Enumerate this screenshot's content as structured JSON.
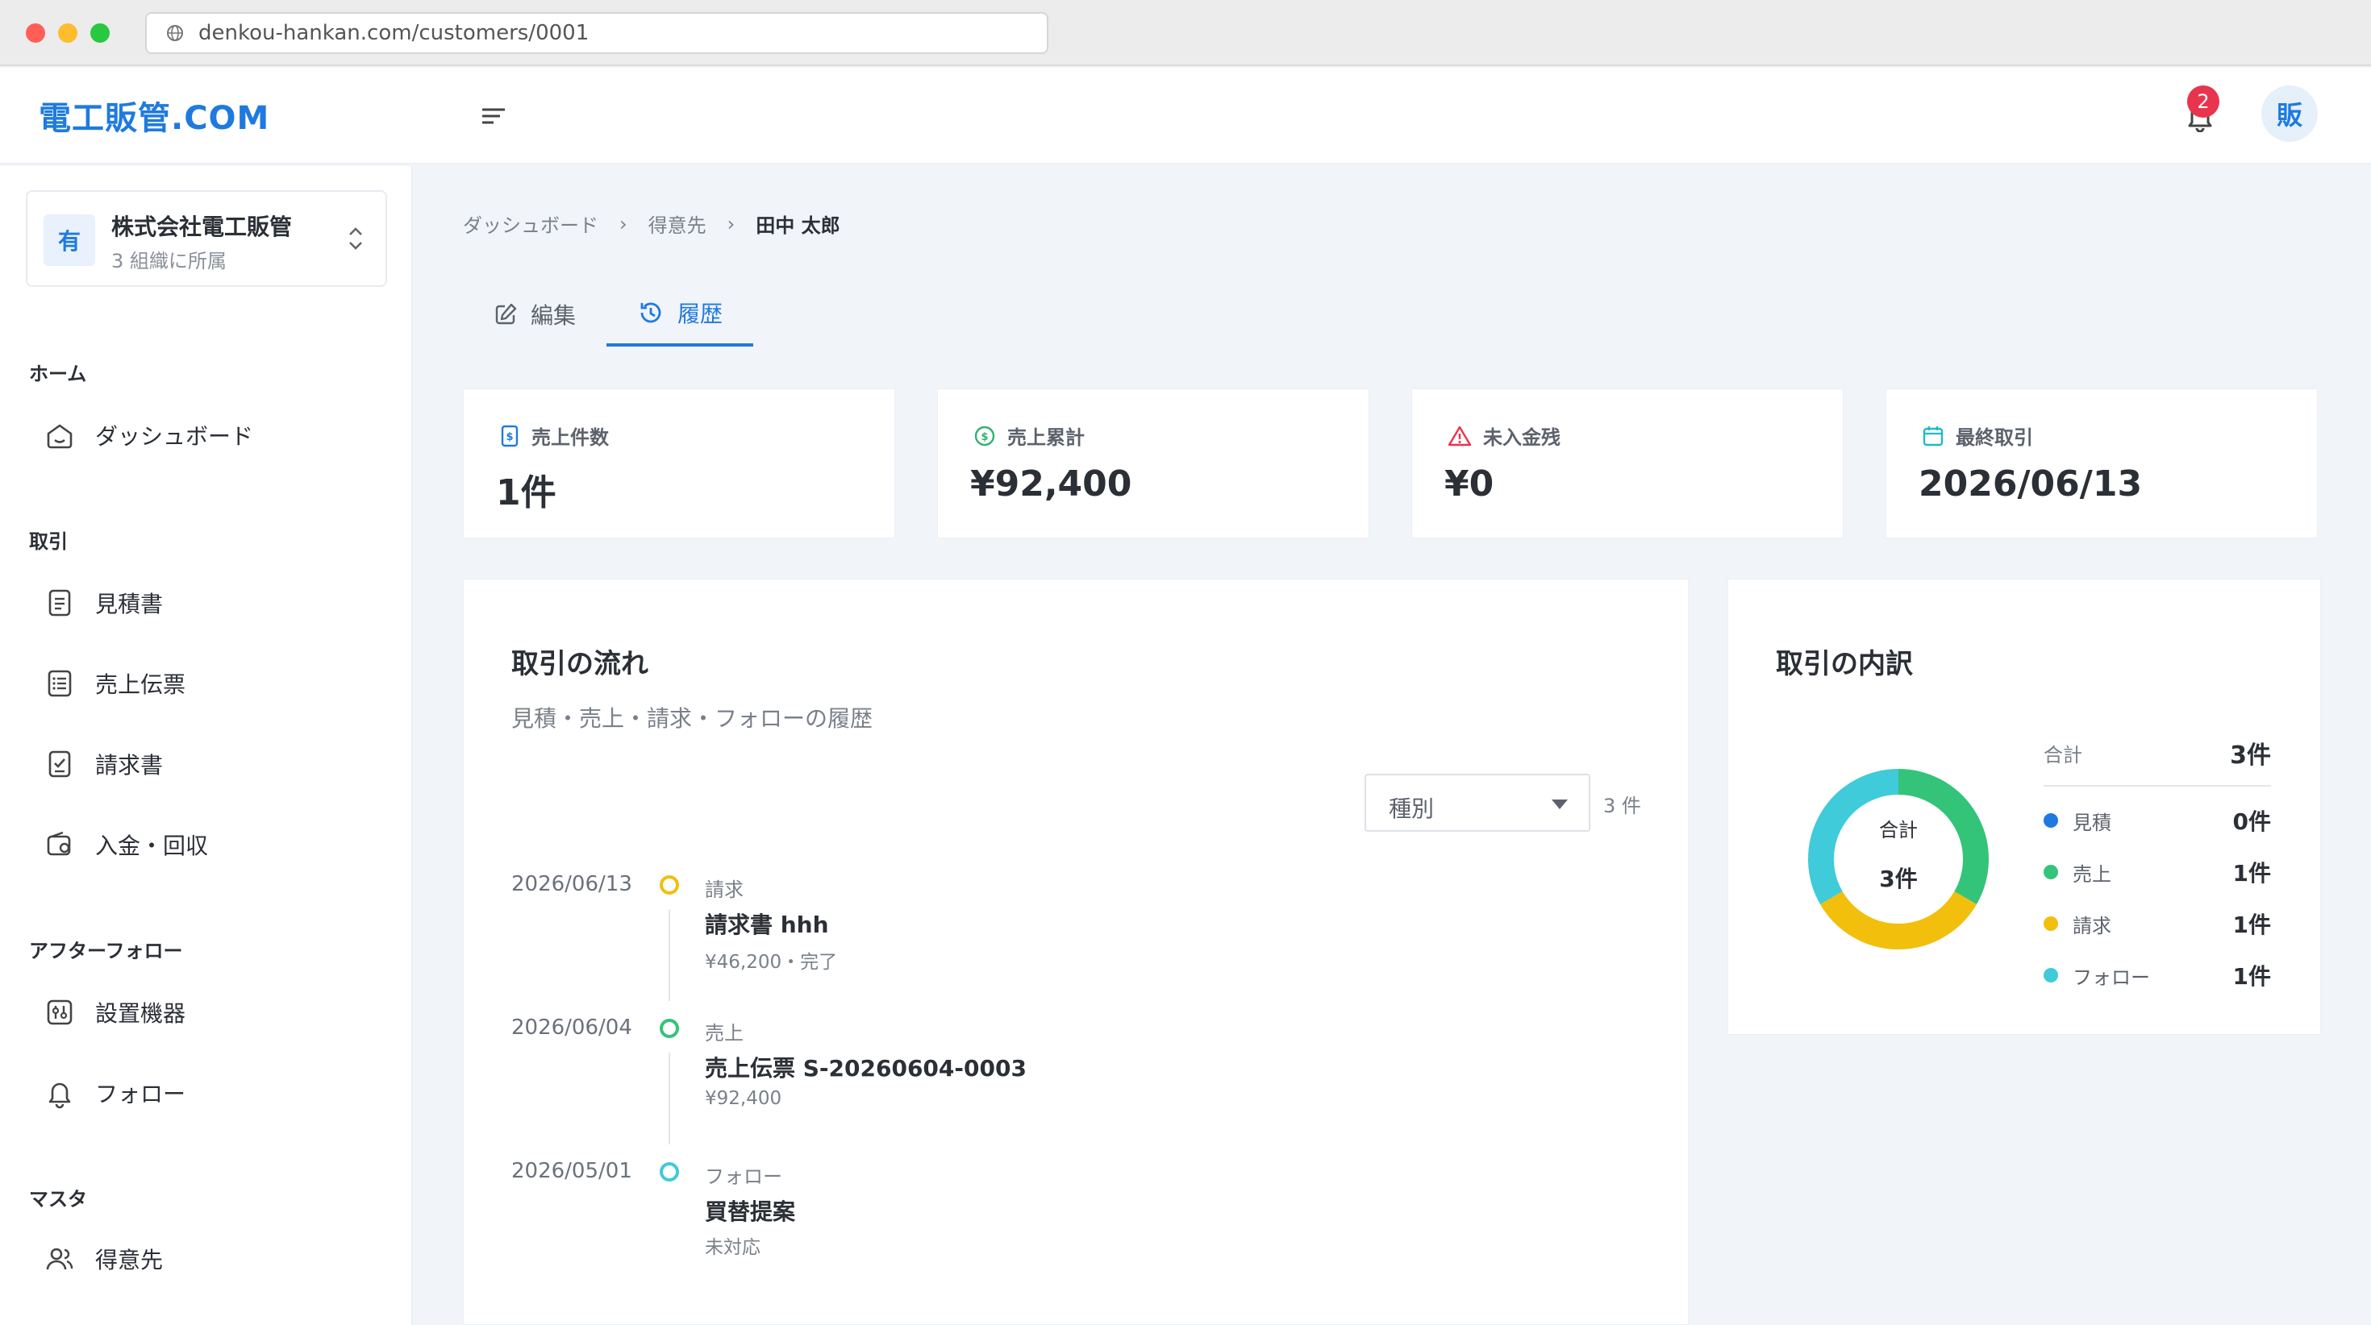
{
  "browser": {
    "url": "denkou-hankan.com/customers/0001"
  },
  "header": {
    "logo": "電工販管.COM",
    "notification_count": "2",
    "avatar": "販"
  },
  "org": {
    "icon": "有",
    "name": "株式会社電工販管",
    "sub": "3 組織に所属"
  },
  "sidebar": {
    "sections": {
      "home": "ホーム",
      "trade": "取引",
      "after": "アフターフォロー",
      "master": "マスタ"
    },
    "items": {
      "dashboard": "ダッシュボード",
      "estimate": "見積書",
      "sales_slip": "売上伝票",
      "invoice": "請求書",
      "payment": "入金・回収",
      "equipment": "設置機器",
      "follow": "フォロー",
      "customers": "得意先"
    }
  },
  "breadcrumb": {
    "first": "ダッシュボード",
    "second": "得意先",
    "current": "田中 太郎"
  },
  "tabs": {
    "edit": "編集",
    "history": "履歴"
  },
  "stats": [
    {
      "label": "売上件数",
      "value": "1件",
      "icon": "receipt-icon",
      "color": "#1f7ae0"
    },
    {
      "label": "売上累計",
      "value": "¥92,400",
      "icon": "coin-icon",
      "color": "#2fb36d"
    },
    {
      "label": "未入金残",
      "value": "¥0",
      "icon": "warning-icon",
      "color": "#e8344e"
    },
    {
      "label": "最終取引",
      "value": "2026/06/13",
      "icon": "calendar-icon",
      "color": "#22b8c9"
    }
  ],
  "flow": {
    "title": "取引の流れ",
    "subtitle": "見積・売上・請求・フォローの履歴",
    "filter_value": "種別",
    "count": "3 件",
    "events": [
      {
        "date": "2026/06/13",
        "type": "請求",
        "title": "請求書 hhh",
        "meta": "¥46,200・完了",
        "color": "#f2bf0c"
      },
      {
        "date": "2026/06/04",
        "type": "売上",
        "title": "売上伝票 S-20260604-0003",
        "meta": "¥92,400",
        "color": "#33c47a"
      },
      {
        "date": "2026/05/01",
        "type": "フォロー",
        "title": "買替提案",
        "meta": "未対応",
        "color": "#3fcbd9"
      }
    ]
  },
  "breakdown": {
    "title": "取引の内訳",
    "total_label": "合計",
    "total_value": "3件",
    "center_label": "合計",
    "center_value": "3件",
    "items": [
      {
        "name": "見積",
        "value": "0件",
        "count": 0,
        "color": "#1f7ae0"
      },
      {
        "name": "売上",
        "value": "1件",
        "count": 1,
        "color": "#33c47a"
      },
      {
        "name": "請求",
        "value": "1件",
        "count": 1,
        "color": "#f2bf0c"
      },
      {
        "name": "フォロー",
        "value": "1件",
        "count": 1,
        "color": "#3fcbd9"
      }
    ]
  }
}
